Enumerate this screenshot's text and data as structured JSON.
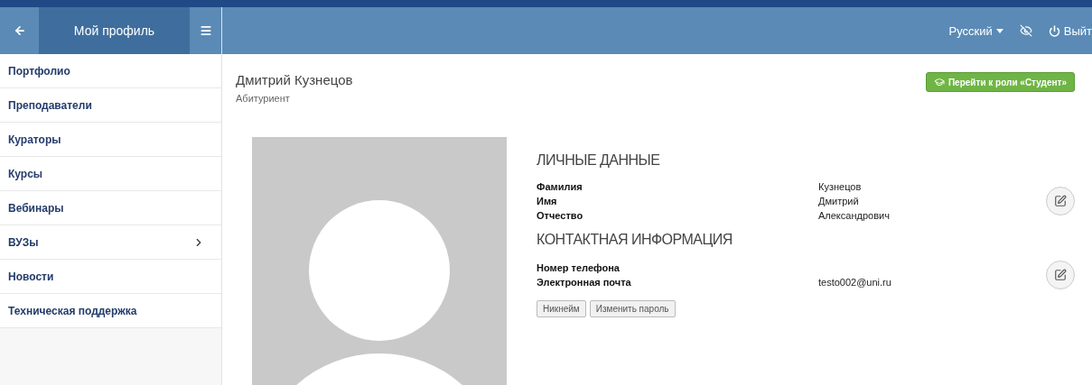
{
  "sidebar": {
    "title": "Мой профиль",
    "items": [
      {
        "label": "Портфолио",
        "expandable": false
      },
      {
        "label": "Преподаватели",
        "expandable": false
      },
      {
        "label": "Кураторы",
        "expandable": false
      },
      {
        "label": "Курсы",
        "expandable": false
      },
      {
        "label": "Вебинары",
        "expandable": false
      },
      {
        "label": "ВУЗы",
        "expandable": true
      },
      {
        "label": "Новости",
        "expandable": false
      },
      {
        "label": "Техническая поддержка",
        "expandable": false
      }
    ]
  },
  "topbar": {
    "language": "Русский",
    "logout": "Выйт"
  },
  "profile": {
    "name": "Дмитрий Кузнецов",
    "role": "Абитуриент",
    "switch_role_button": "Перейти к роли «Студент»",
    "sections": [
      {
        "title": "ЛИЧНЫЕ ДАННЫЕ",
        "fields": [
          {
            "label": "Фамилия",
            "value": "Кузнецов"
          },
          {
            "label": "Имя",
            "value": "Дмитрий"
          },
          {
            "label": "Отчество",
            "value": "Александрович"
          }
        ]
      },
      {
        "title": "КОНТАКТНАЯ ИНФОРМАЦИЯ",
        "fields": [
          {
            "label": "Номер телефона"
          },
          {
            "label": "Электронная почта",
            "value": "testo002@uni.ru"
          }
        ]
      }
    ],
    "buttons": [
      "Никнейм",
      "Изменить пароль"
    ]
  }
}
